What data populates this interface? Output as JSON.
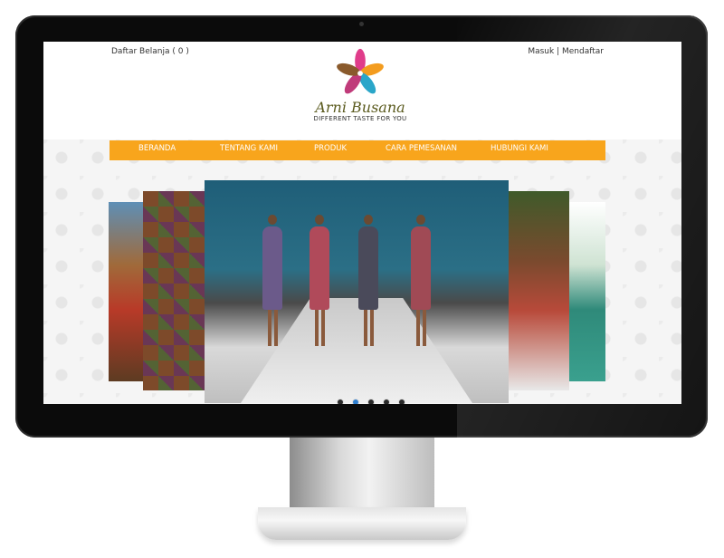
{
  "site": {
    "cart_label": "Daftar Belanja ( 0 )",
    "login_label": "Masuk",
    "separator": "|",
    "register_label": "Mendaftar",
    "logo": {
      "name": "Arni Busana",
      "tagline": "DIFFERENT TASTE FOR YOU",
      "petal_colors": [
        "#e03c8a",
        "#f39c1f",
        "#2aa6c9",
        "#8a5a2c",
        "#c03b7a"
      ]
    },
    "nav": {
      "background": "#f8a51c",
      "items": [
        {
          "label": "BERANDA"
        },
        {
          "label": "TENTANG KAMI"
        },
        {
          "label": "PRODUK"
        },
        {
          "label": "CARA PEMESANAN"
        },
        {
          "label": "HUBUNGI KAMI"
        }
      ]
    },
    "slider": {
      "slide_count": 5,
      "active_index": 1,
      "dot_active_color": "#2f7fd0"
    }
  }
}
